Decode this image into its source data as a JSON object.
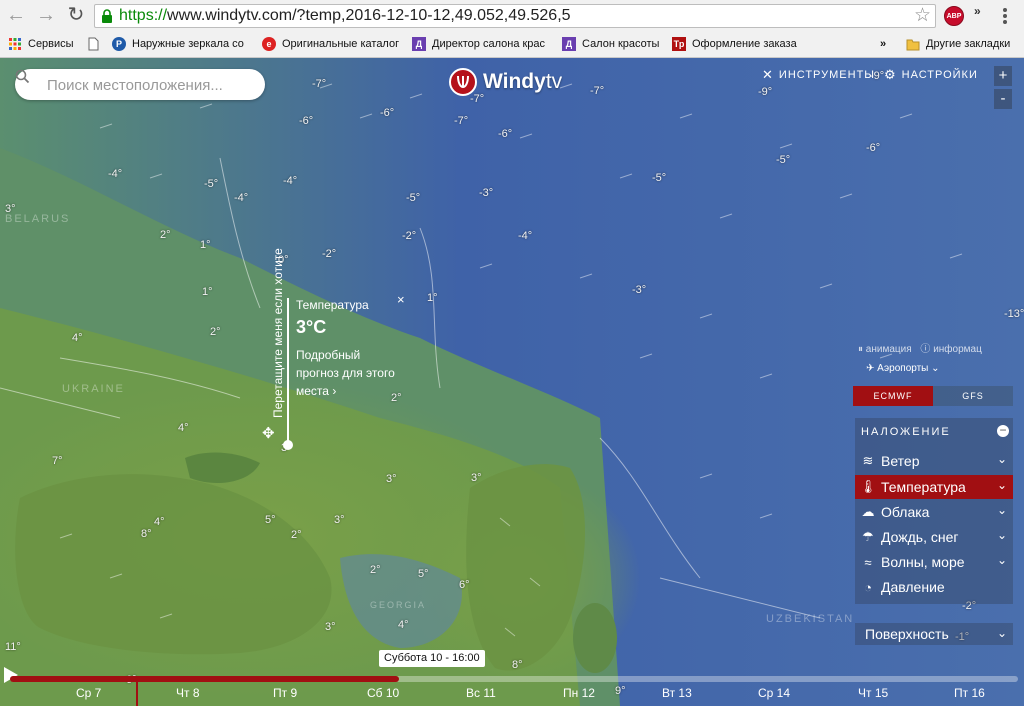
{
  "browser": {
    "url_scheme": "https://",
    "url_rest": "www.windytv.com/?temp,2016-12-10-12,49.052,49.526,5",
    "adblock_label": "ABP",
    "more_extensions": "»",
    "bookmarks": [
      {
        "label": "Сервисы",
        "icon": "apps-grid-icon"
      },
      {
        "label": "",
        "icon": "page-icon"
      },
      {
        "label": "Наружные зеркала со",
        "icon": "p-circle-icon"
      },
      {
        "label": "Оригинальные каталог",
        "icon": "e-logo-icon"
      },
      {
        "label": "Директор салона крас",
        "icon": "d-square-icon"
      },
      {
        "label": "Салон красоты",
        "icon": "d-square-icon"
      },
      {
        "label": "Оформление заказа",
        "icon": "tp-logo-icon"
      }
    ],
    "bookmarks_overflow": "»",
    "other_bookmarks": "Другие закладки"
  },
  "search": {
    "placeholder": "Поиск местоположения..."
  },
  "logo": {
    "name": "Windy",
    "suffix": "tv"
  },
  "topmenu": {
    "tools": "ИНСТРУМЕНТЫ",
    "settings": "НАСТРОЙКИ"
  },
  "zoom": {
    "in": "+",
    "out": "-"
  },
  "popup": {
    "drag_hint": "Перетащите меня если хотите",
    "title": "Температура",
    "value": "3°C",
    "link_line1": "Подробный",
    "link_line2": "прогноз для этого",
    "link_line3": "места",
    "close": "×"
  },
  "side": {
    "animation": "анимация",
    "info": "информац",
    "airports": "Аэропорты",
    "models": [
      "ECMWF",
      "GFS"
    ],
    "active_model": "ECMWF"
  },
  "overlay": {
    "heading": "НАЛОЖЕНИЕ",
    "items": [
      {
        "label": "Ветер",
        "icon": "wind-icon",
        "has_chevron": true
      },
      {
        "label": "Температура",
        "icon": "thermometer-icon",
        "has_chevron": true,
        "active": true
      },
      {
        "label": "Облака",
        "icon": "cloud-icon",
        "has_chevron": true
      },
      {
        "label": "Дождь, снег",
        "icon": "rain-icon",
        "has_chevron": true
      },
      {
        "label": "Волны, море",
        "icon": "waves-icon",
        "has_chevron": true
      },
      {
        "label": "Давление",
        "icon": "gauge-icon",
        "has_chevron": false
      }
    ],
    "surface": "Поверхность"
  },
  "timeline": {
    "current_label": "Суббота 10 - 16:00",
    "progress": 0.386,
    "days": [
      "Ср 7",
      "Чт 8",
      "Пт 9",
      "Сб 10",
      "Вс 11",
      "Пн 12",
      "Вт 13",
      "Ср 14",
      "Чт 15",
      "Пт 16"
    ]
  },
  "map": {
    "countries": [
      "BELARUS",
      "UKRAINE",
      "GEORGIA",
      "UZBEKISTAN"
    ],
    "temperatures": [
      "-7°",
      "-9°",
      "-7°",
      "-6°",
      "-7°",
      "-9°",
      "-7°",
      "-6°",
      "-6°",
      "-6°",
      "-5°",
      "-4°",
      "-5°",
      "-4°",
      "-4°",
      "-5°",
      "-3°",
      "-5°",
      "3°",
      "2°",
      "1°",
      "0°",
      "-2°",
      "-2°",
      "-4°",
      "-3°",
      "1°",
      "1°",
      "-13°",
      "2°",
      "4°",
      "2°",
      "4°",
      "7°",
      "4°",
      "8°",
      "5°",
      "3°",
      "2°",
      "3°",
      "3°",
      "3°",
      "6°",
      "2°",
      "5°",
      "3°",
      "4°",
      "11°",
      "6°",
      "8°",
      "9°",
      "-2°",
      "-1°",
      "3°"
    ],
    "colors": {
      "cold": "#3f62a8",
      "mid": "#4f8a7c",
      "warm": "#6f9a48",
      "accent": "#a10f12"
    }
  }
}
